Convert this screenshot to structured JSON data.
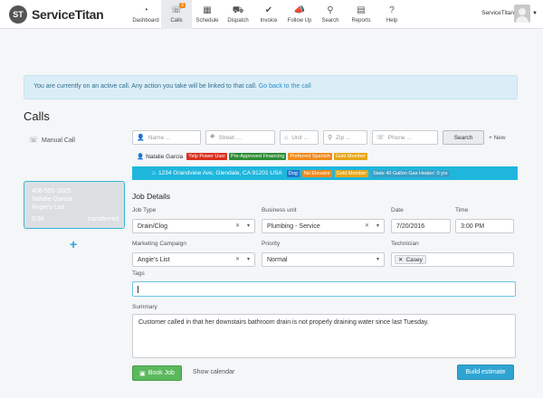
{
  "app": {
    "logo_text": "ServiceTitan",
    "user_name": "ServiceTitan"
  },
  "nav": [
    {
      "key": "dashboard",
      "label": "Dashboard",
      "icon": "speedometer-icon",
      "glyph": "◔"
    },
    {
      "key": "calls",
      "label": "Calls",
      "icon": "phone-icon",
      "glyph": "☏",
      "badge": "3",
      "active": true
    },
    {
      "key": "schedule",
      "label": "Schedule",
      "icon": "calendar-icon",
      "glyph": "▦"
    },
    {
      "key": "dispatch",
      "label": "Dispatch",
      "icon": "truck-icon",
      "glyph": "⛟"
    },
    {
      "key": "invoice",
      "label": "Invoice",
      "icon": "checkmark-circle-icon",
      "glyph": "✔"
    },
    {
      "key": "followup",
      "label": "Follow Up",
      "icon": "megaphone-icon",
      "glyph": "📣"
    },
    {
      "key": "search",
      "label": "Search",
      "icon": "search-icon",
      "glyph": "⚲"
    },
    {
      "key": "reports",
      "label": "Reports",
      "icon": "book-icon",
      "glyph": "▤"
    },
    {
      "key": "help",
      "label": "Help",
      "icon": "question-icon",
      "glyph": "?"
    }
  ],
  "alert": {
    "text": "You are currently on an active call. Any action you take will be linked to that call.",
    "link": "Go back to the call"
  },
  "page_title": "Calls",
  "calls_panel": {
    "manual_call_label": "Manual Call",
    "active_call": {
      "phone": "408-555-3505",
      "name": "Natalie Garcia",
      "location": "Angie's List",
      "duration": "0:36",
      "status": "transferred"
    }
  },
  "search": {
    "name_placeholder": "Name ...",
    "street_placeholder": "Street ...",
    "unit_placeholder": "Unit ...",
    "zip_placeholder": "Zip ...",
    "phone_placeholder": "Phone ...",
    "search_button": "Search",
    "new_button": "+ New"
  },
  "customer": {
    "name": "Natalie Garcia",
    "tags": [
      {
        "label": "Yelp Power User",
        "color": "#d9301f"
      },
      {
        "label": "Pre-Approved Financing",
        "color": "#2e8b35"
      },
      {
        "label": "Preferred Spanish",
        "color": "#f08a1c"
      },
      {
        "label": "Gold Member",
        "color": "#e6a617"
      }
    ]
  },
  "address": {
    "text": "1234 Grandview Ave, Glendale, CA 91201 USA",
    "tags": [
      {
        "label": "Dog",
        "color": "#2277c8"
      },
      {
        "label": "No Elevator",
        "color": "#f08a1c"
      },
      {
        "label": "Gold Member",
        "color": "#e6a617"
      },
      {
        "label": "State 40 Gallon Gas Heater: 0 yrs",
        "color": "#3a9fc6"
      }
    ]
  },
  "job_details": {
    "title": "Job Details",
    "job_type": {
      "label": "Job Type",
      "value": "Drain/Clog"
    },
    "business_unit": {
      "label": "Business unit",
      "value": "Plumbing - Service"
    },
    "date": {
      "label": "Date",
      "value": "7/20/2016"
    },
    "time": {
      "label": "Time",
      "value": "3:00 PM"
    },
    "marketing_campaign": {
      "label": "Marketing Campaign",
      "value": "Angie's List"
    },
    "priority": {
      "label": "Priority",
      "value": "Normal"
    },
    "technician": {
      "label": "Technician",
      "value": "Casey"
    },
    "tags": {
      "label": "Tags",
      "value": ""
    },
    "summary": {
      "label": "Summary",
      "value": "Customer called in that her downstairs bathroom drain is not properly draining water since last Tuesday."
    }
  },
  "actions": {
    "book_job": "Book Job",
    "show_calendar": "Show calendar",
    "build_estimate": "Build estimate"
  }
}
